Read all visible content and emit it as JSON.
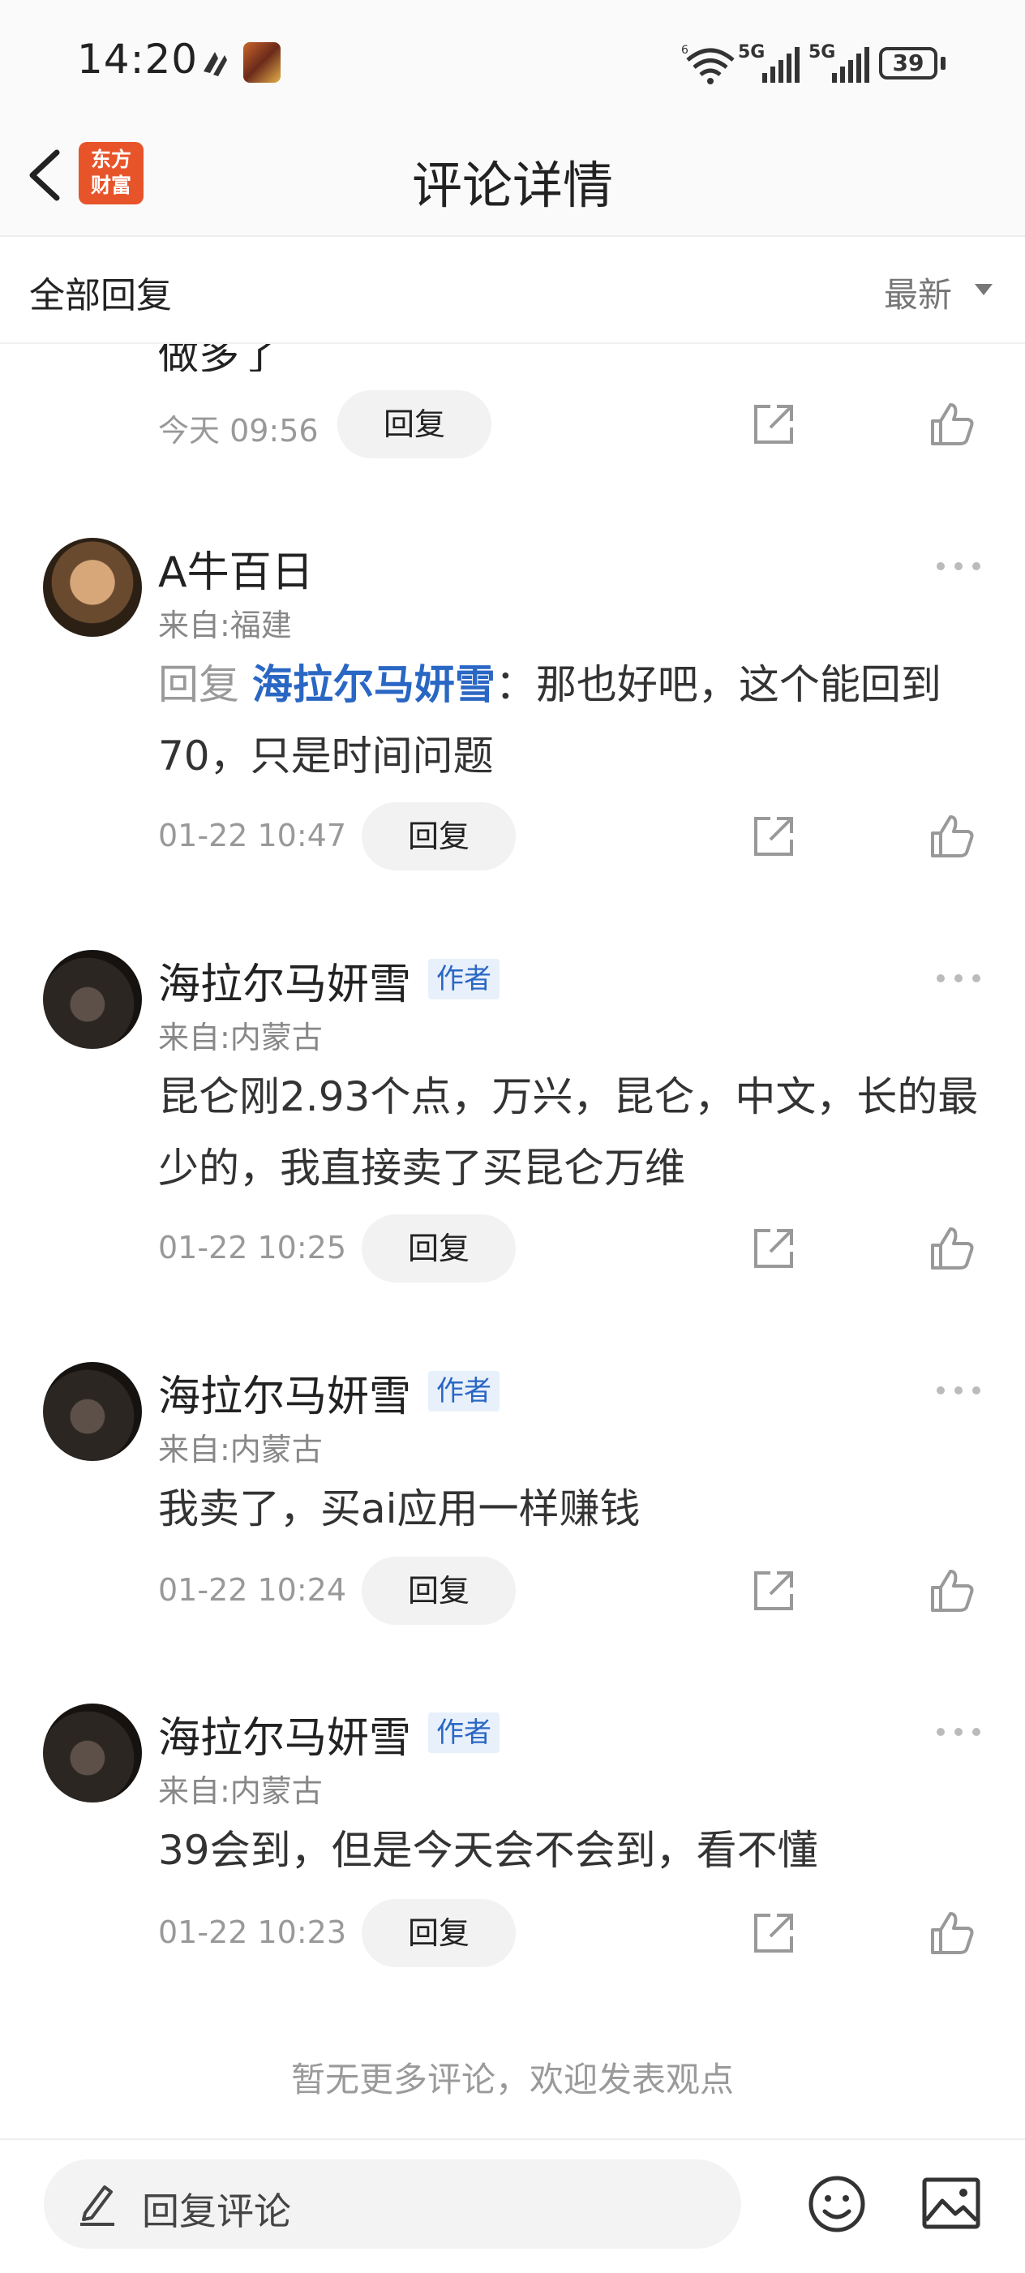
{
  "status_bar": {
    "time": "14:20",
    "battery": "39",
    "network_1": "5G",
    "network_2": "5G"
  },
  "header": {
    "title": "评论详情",
    "logo_line1": "东方",
    "logo_line2": "财富"
  },
  "subheader": {
    "all_replies": "全部回复",
    "sort": "最新"
  },
  "top_partial": {
    "cut_text": "做多了",
    "time": "今天 09:56",
    "reply_label": "回复"
  },
  "comments": [
    {
      "username": "A牛百日",
      "is_author": false,
      "location": "来自:福建",
      "reply_prefix": "回复 ",
      "reply_to": "海拉尔马妍雪",
      "content": "：那也好吧，这个能回到70，只是时间问题",
      "time": "01-22 10:47",
      "reply_label": "回复"
    },
    {
      "username": "海拉尔马妍雪",
      "is_author": true,
      "author_badge": "作者",
      "location": "来自:内蒙古",
      "content": "昆仑刚2.93个点，万兴，昆仑，中文，长的最少的，我直接卖了买昆仑万维",
      "time": "01-22 10:25",
      "reply_label": "回复"
    },
    {
      "username": "海拉尔马妍雪",
      "is_author": true,
      "author_badge": "作者",
      "location": "来自:内蒙古",
      "content": "我卖了，买ai应用一样赚钱",
      "time": "01-22 10:24",
      "reply_label": "回复"
    },
    {
      "username": "海拉尔马妍雪",
      "is_author": true,
      "author_badge": "作者",
      "location": "来自:内蒙古",
      "content": "39会到，但是今天会不会到，看不懂",
      "time": "01-22 10:23",
      "reply_label": "回复"
    }
  ],
  "footer_note": "暂无更多评论，欢迎发表观点",
  "bottom_bar": {
    "placeholder": "回复评论"
  },
  "colors": {
    "brand": "#e8542a",
    "link": "#2a67c4",
    "muted": "#999999"
  }
}
